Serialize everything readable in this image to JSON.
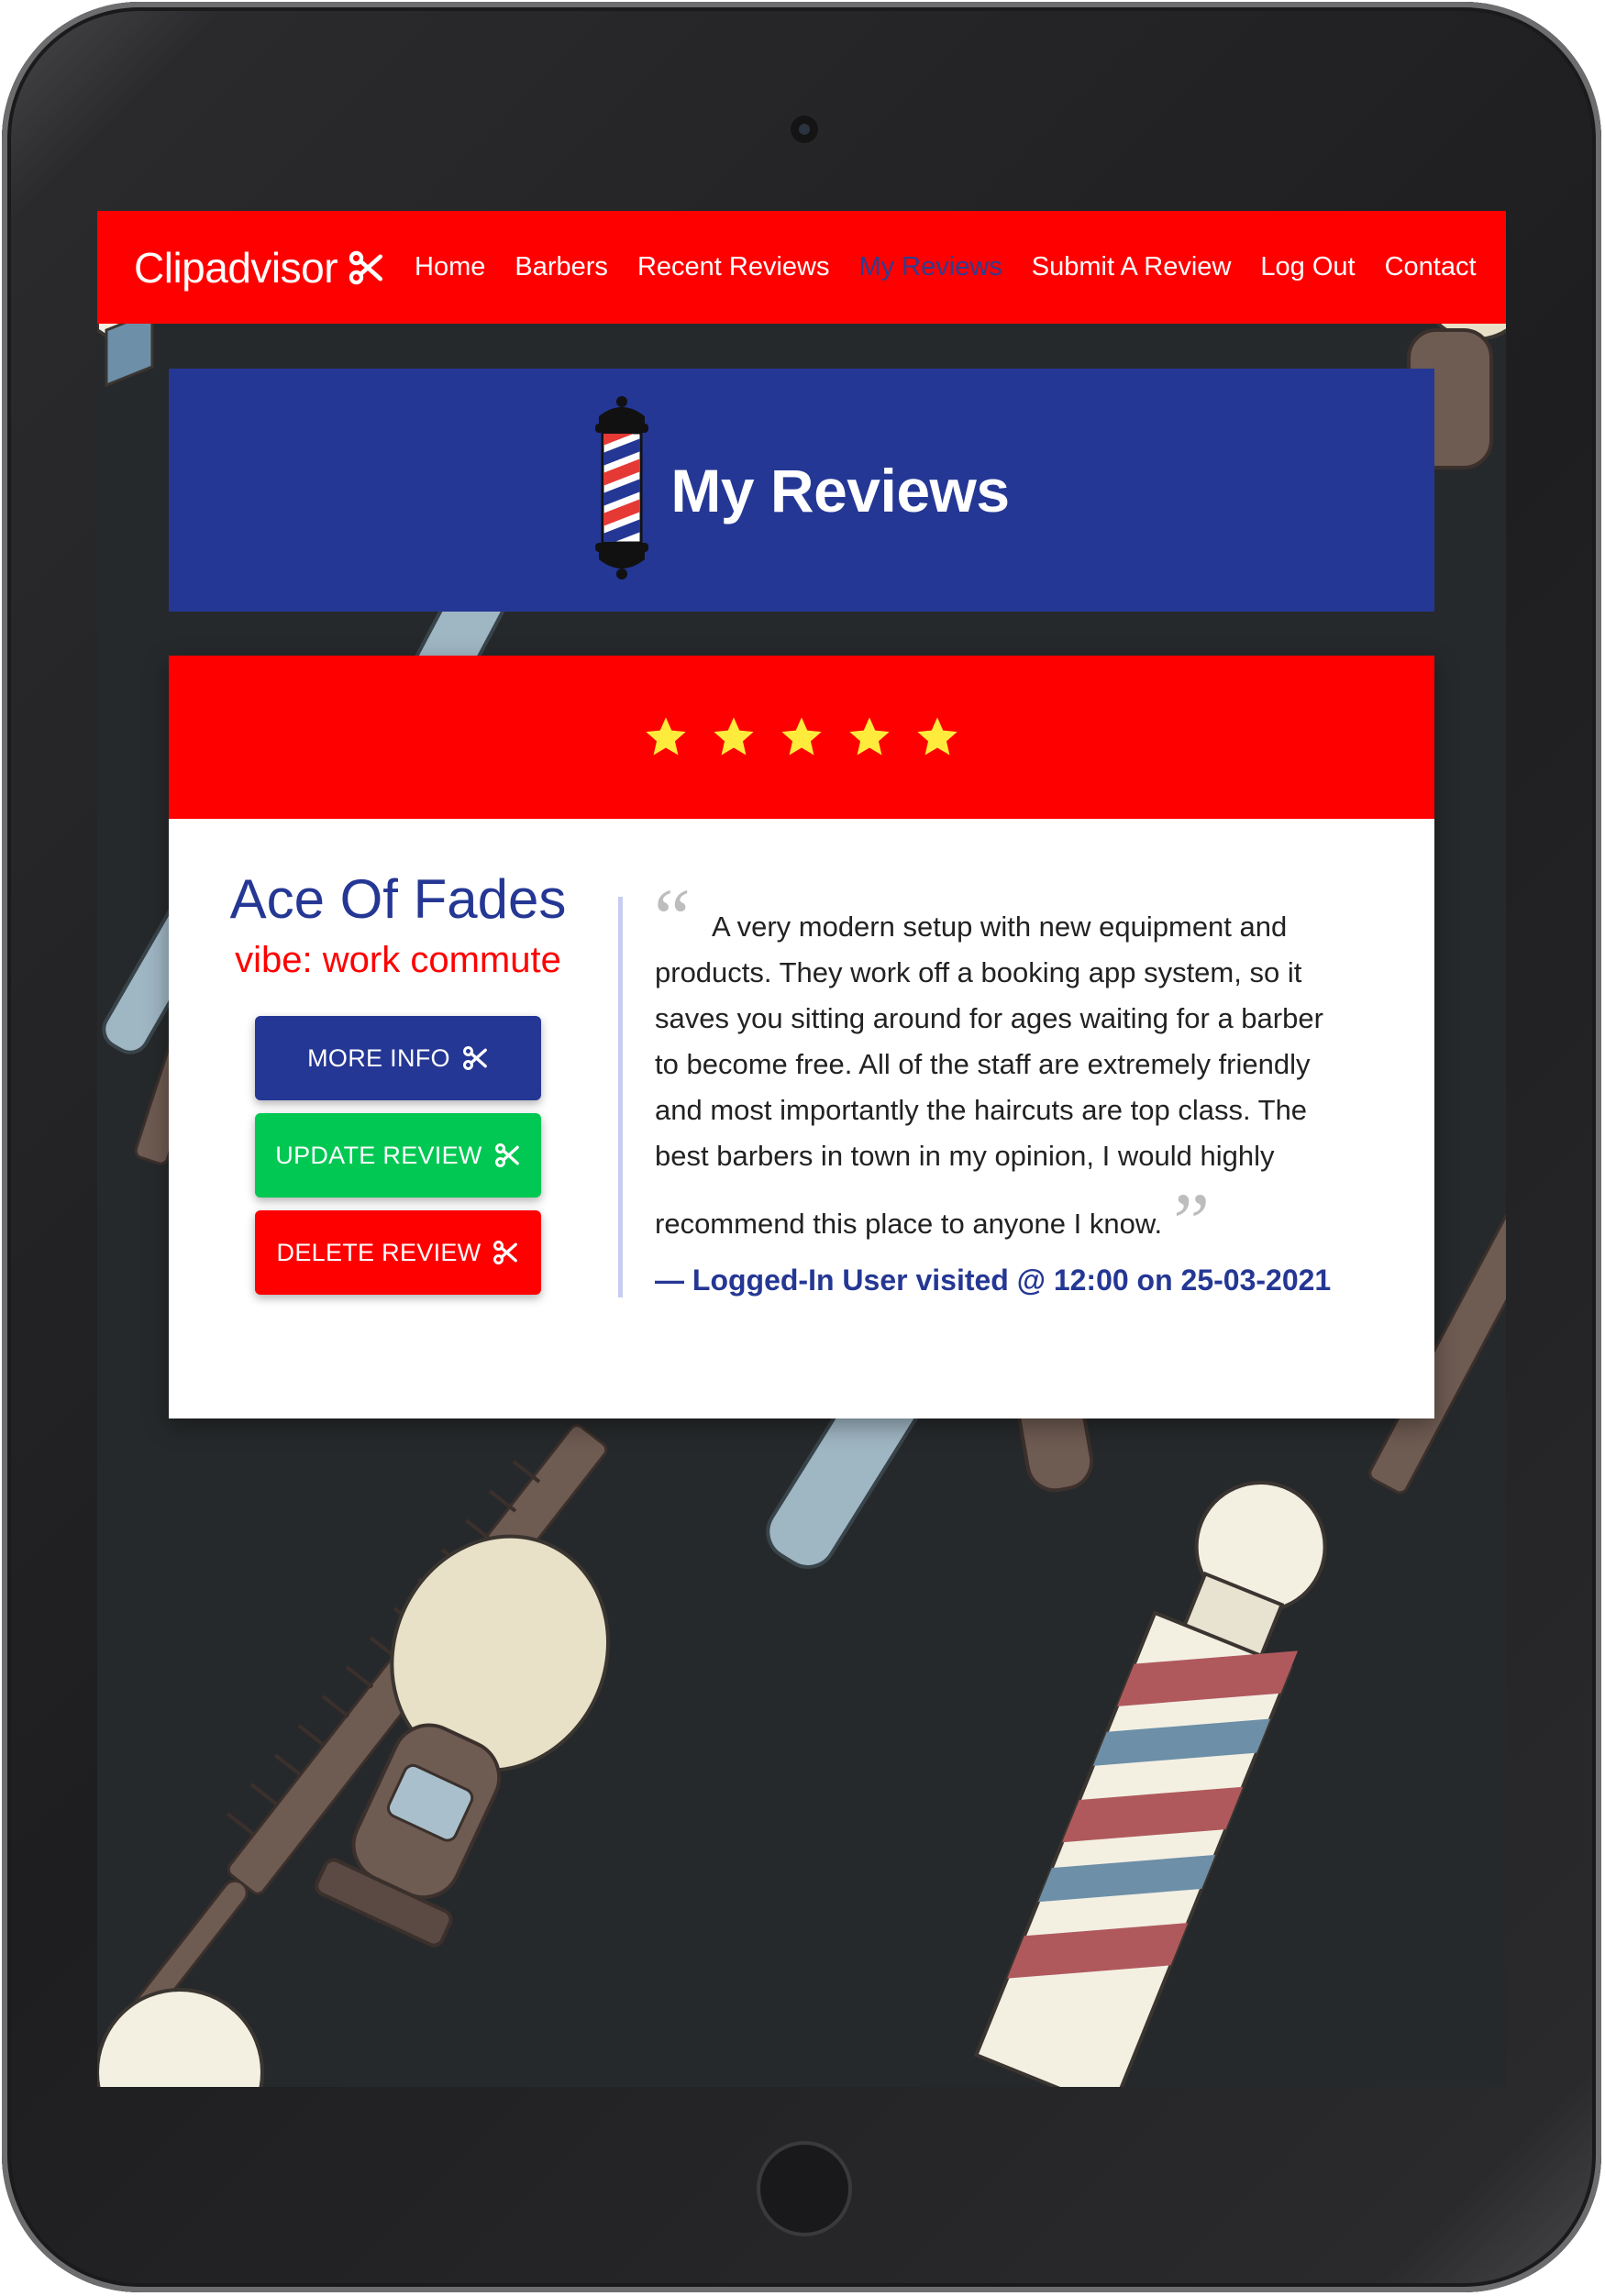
{
  "navbar": {
    "brand": "Clipadvisor",
    "links": [
      "Home",
      "Barbers",
      "Recent Reviews",
      "My Reviews",
      "Submit A Review",
      "Log Out",
      "Contact"
    ],
    "active": "My Reviews"
  },
  "banner": {
    "title": "My Reviews"
  },
  "review": {
    "stars": 5,
    "barber_name": "Ace Of Fades",
    "vibe": "vibe: work commute",
    "buttons": {
      "more_info": "MORE INFO",
      "update": "UPDATE REVIEW",
      "delete": "DELETE REVIEW"
    },
    "text": "A very modern setup with new equipment and products. They work off a booking app system, so it saves you sitting around for ages waiting for a barber to become free. All of the staff are extremely friendly and most importantly the haircuts are top class. The best barbers in town in my opinion, I would highly recommend this place to anyone I know.",
    "visit_line": "— Logged-In User visited @ 12:00 on 25-03-2021"
  },
  "colors": {
    "primary_red": "#ff0000",
    "primary_blue": "#253794",
    "success_green": "#00c853",
    "star_yellow": "#ffeb3b"
  },
  "icons": {
    "brand": "scissors-icon",
    "banner": "barber-pole-icon",
    "buttons": "scissors-icon",
    "rating": "star-icon"
  }
}
